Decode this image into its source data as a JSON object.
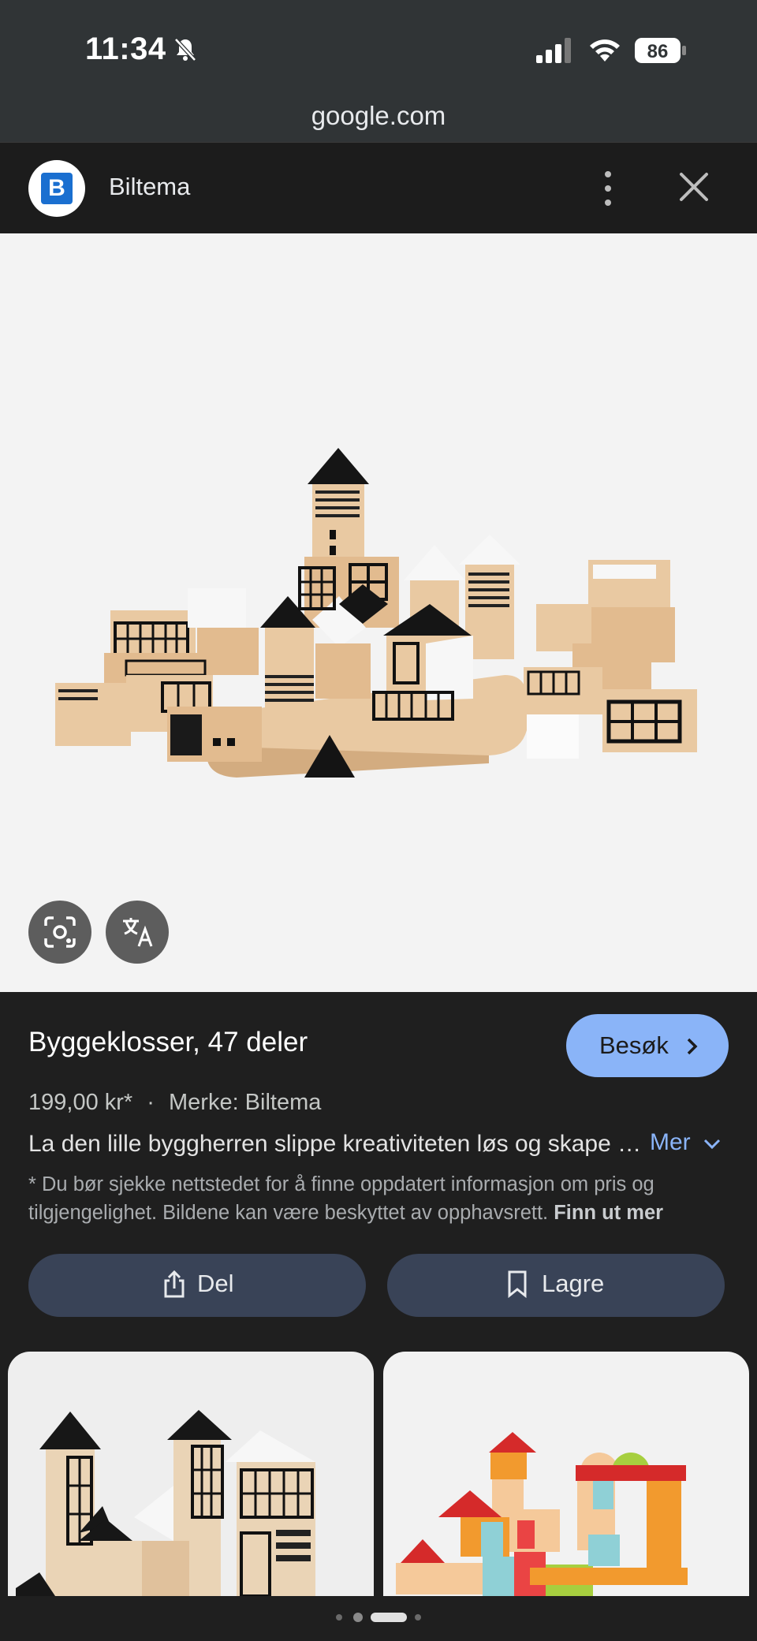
{
  "status": {
    "time": "11:34",
    "battery": "86"
  },
  "browser": {
    "url": "google.com"
  },
  "header": {
    "site_name": "Biltema",
    "logo_letter": "B"
  },
  "product": {
    "title": "Byggeklosser, 47 deler",
    "visit_label": "Besøk",
    "price": "199,00 kr*",
    "brand": "Merke: Biltema",
    "separator": "·",
    "description": "La den lille byggherren slippe kreativiteten løs og skape sin egen by med disse byggeklossene",
    "more_label": "Mer",
    "disclaimer": "* Du bør sjekke nettstedet for å finne oppdatert informasjon om pris og tilgjengelighet. Bildene kan være beskyttet av opphavsrett.",
    "learn_more": "Finn ut mer"
  },
  "actions": {
    "share_label": "Del",
    "save_label": "Lagre"
  },
  "colors": {
    "accent": "#8ab4f8",
    "button_bg": "#394357",
    "background": "#1f1f1f"
  }
}
